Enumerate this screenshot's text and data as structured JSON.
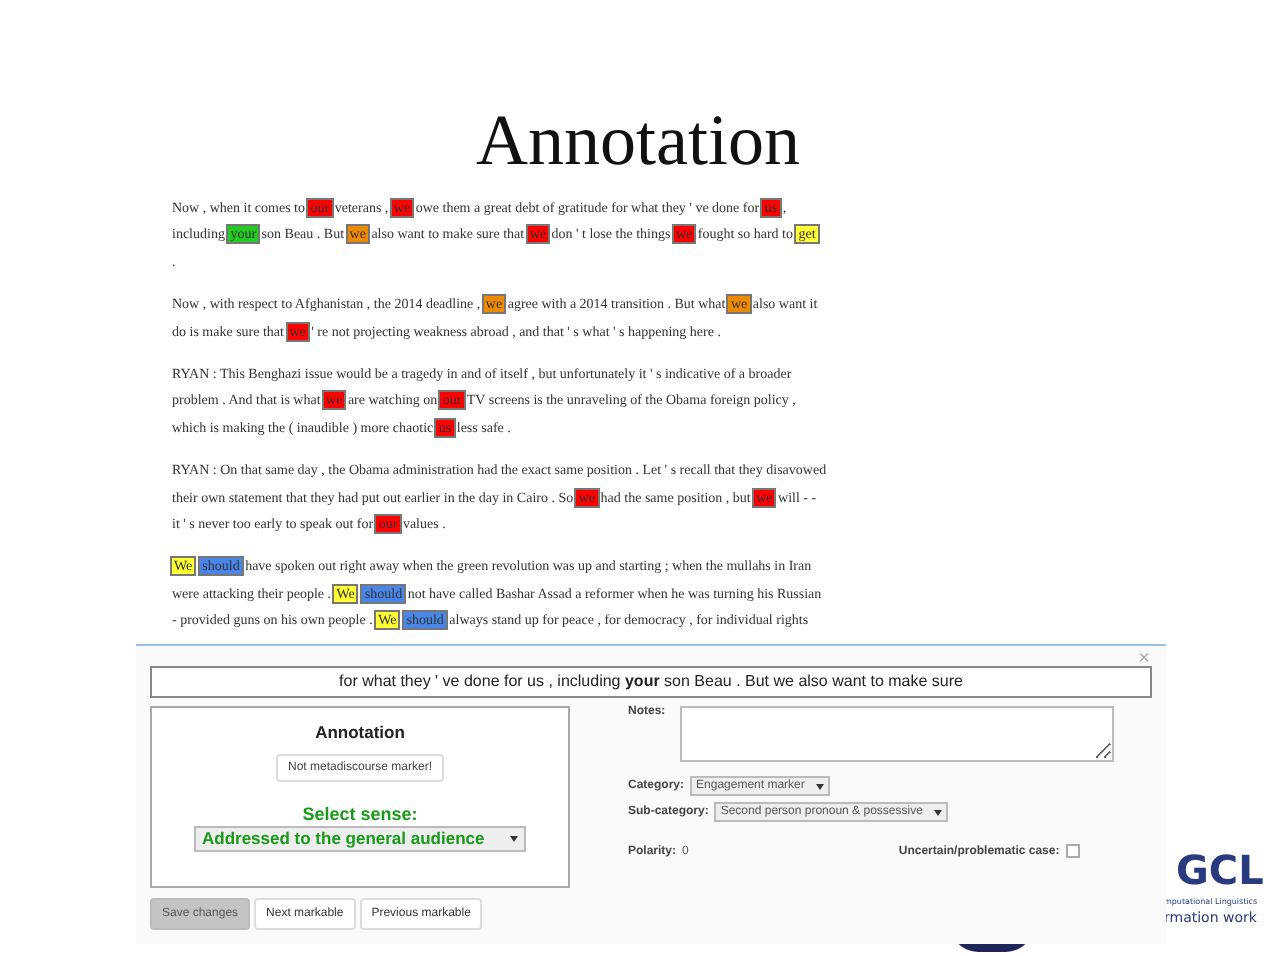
{
  "slide_title": "Annotation",
  "paragraphs": [
    [
      [
        {
          "text": "Now , when it comes to "
        },
        {
          "text": "our",
          "color": "#ff0000"
        },
        {
          "text": " veterans , "
        },
        {
          "text": "we",
          "color": "#ff0000"
        },
        {
          "text": " owe them a great debt of gratitude for what they ' ve done for "
        },
        {
          "text": "us",
          "color": "#ff0000"
        },
        {
          "text": " ,"
        }
      ],
      [
        {
          "text": "including "
        },
        {
          "text": "your",
          "color": "#22cc22"
        },
        {
          "text": " son Beau . But "
        },
        {
          "text": "we",
          "color": "#ee8a00"
        },
        {
          "text": " also want to make sure that "
        },
        {
          "text": "we",
          "color": "#ff0000"
        },
        {
          "text": " don ' t lose the things "
        },
        {
          "text": "we",
          "color": "#ff0000"
        },
        {
          "text": " fought so hard to "
        },
        {
          "text": "get",
          "color": "#ffff33"
        }
      ],
      [
        {
          "text": "."
        }
      ]
    ],
    [
      [
        {
          "text": "Now , with respect to Afghanistan , the 2014 deadline , "
        },
        {
          "text": "we",
          "color": "#ee8a00"
        },
        {
          "text": " agree with a 2014 transition . But what "
        },
        {
          "text": "we",
          "color": "#ee8a00"
        },
        {
          "text": " also want it"
        }
      ],
      [
        {
          "text": "do is make sure that "
        },
        {
          "text": "we",
          "color": "#ff0000"
        },
        {
          "text": " ' re not projecting weakness abroad , and that ' s what ' s happening here ."
        }
      ]
    ],
    [
      [
        {
          "text": "RYAN : This Benghazi issue would be a tragedy in and of itself , but unfortunately it ' s indicative of a broader"
        }
      ],
      [
        {
          "text": "problem . And that is what "
        },
        {
          "text": "we",
          "color": "#ff0000"
        },
        {
          "text": " are watching on "
        },
        {
          "text": "our",
          "color": "#ff0000"
        },
        {
          "text": " TV screens is the unraveling of the Obama foreign policy ,"
        }
      ],
      [
        {
          "text": "which is making the ( inaudible ) more chaotic "
        },
        {
          "text": "us",
          "color": "#ff0000"
        },
        {
          "text": " less safe ."
        }
      ]
    ],
    [
      [
        {
          "text": "RYAN : On that same day , the Obama administration had the exact same position . Let ' s recall that they disavowed"
        }
      ],
      [
        {
          "text": "their own statement that they had put out earlier in the day in Cairo . So "
        },
        {
          "text": "we",
          "color": "#ff0000"
        },
        {
          "text": " had the same position , but "
        },
        {
          "text": "we",
          "color": "#ff0000"
        },
        {
          "text": " will - -"
        }
      ],
      [
        {
          "text": "it ' s never too early to speak out for "
        },
        {
          "text": "our",
          "color": "#ff0000"
        },
        {
          "text": " values ."
        }
      ]
    ],
    [
      [
        {
          "text": "We",
          "color": "#ffff33"
        },
        {
          "text": "should",
          "color": "#4a86e8"
        },
        {
          "text": " have spoken out right away when the green revolution was up and starting ; when the mullahs in Iran"
        }
      ],
      [
        {
          "text": "were attacking their people . "
        },
        {
          "text": "We",
          "color": "#ffff33"
        },
        {
          "text": "should",
          "color": "#4a86e8"
        },
        {
          "text": " not have called Bashar Assad a reformer when he was turning his Russian"
        }
      ],
      [
        {
          "text": "- provided guns on his own people . "
        },
        {
          "text": "We",
          "color": "#ffff33"
        },
        {
          "text": "should",
          "color": "#4a86e8"
        },
        {
          "text": " always stand up for peace , for democracy , for individual rights"
        }
      ]
    ]
  ],
  "dialog": {
    "close": "×",
    "context": "for what they ' ve done for us , including **your** son Beau . But we also want to make sure",
    "annotation_title": "Annotation",
    "not_marker_button": "Not metadiscourse marker!",
    "sense_label": "Select sense:",
    "sense_value": "Addressed to the general audience",
    "buttons": [
      {
        "label": "Save changes",
        "disabled": true
      },
      {
        "label": "Next markable",
        "disabled": false
      },
      {
        "label": "Previous markable",
        "disabled": false
      }
    ],
    "notes_label": "Notes:",
    "category_label": "Category:",
    "category_value": "Engagement marker",
    "subcategory_label": "Sub-category:",
    "subcategory_value": "Second person pronoun & possessive",
    "polarity_label": "Polarity:",
    "polarity_value": "0",
    "uncertain_label": "Uncertain/problematic case:",
    "uncertain_checked": false
  },
  "logo": {
    "letters": "GCL",
    "line_1": "mputational Linguistics",
    "line_2": "rmation work"
  }
}
